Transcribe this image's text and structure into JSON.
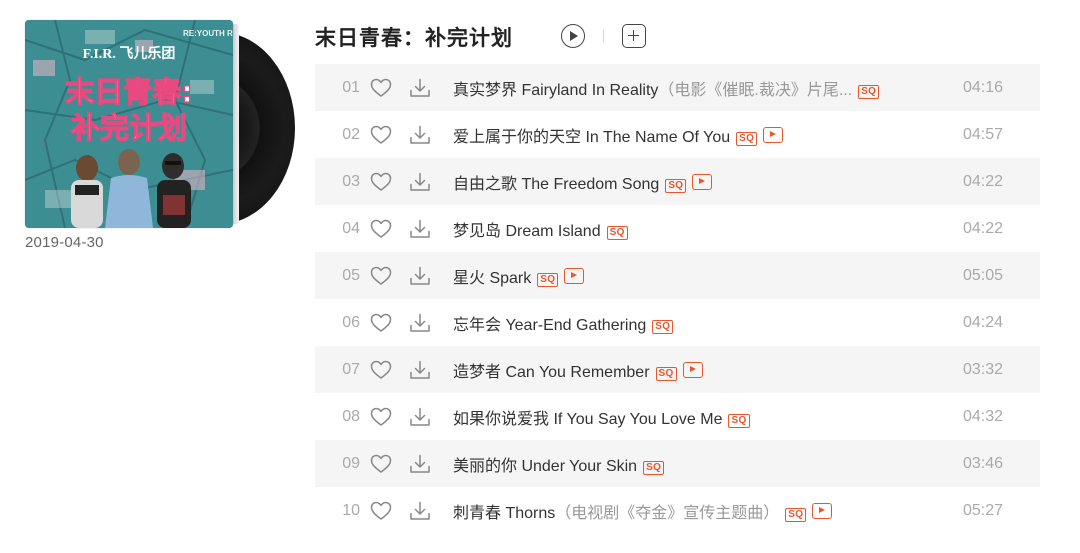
{
  "album": {
    "title": "末日青春：补完计划",
    "release_date": "2019-04-30",
    "cover": {
      "band_logo": "F.I.R. 飞儿乐团",
      "title_line1": "末日青春:",
      "title_line2": "补完计划",
      "side_text": "RE:YOUTH RE:YOUTH",
      "colors": {
        "teal": "#3d8e93",
        "pink": "#e84a7f",
        "white": "#ffffff"
      }
    }
  },
  "actions": {
    "play_all_icon": "play-circle-icon",
    "add_icon": "add-to-playlist-icon"
  },
  "colors": {
    "accent": "#e8562c",
    "row_stripe": "#f5f5f5",
    "muted_text": "#aaaaaa"
  },
  "tracks": [
    {
      "no": "01",
      "title": "真实梦界 Fairyland In Reality",
      "note": "（电影《催眠.裁决》片尾...",
      "sq": "SQ",
      "mv": false,
      "duration": "04:16"
    },
    {
      "no": "02",
      "title": "爱上属于你的天空 In The Name Of You",
      "note": "",
      "sq": "SQ",
      "mv": true,
      "duration": "04:57"
    },
    {
      "no": "03",
      "title": "自由之歌 The Freedom Song",
      "note": "",
      "sq": "SQ",
      "mv": true,
      "duration": "04:22"
    },
    {
      "no": "04",
      "title": "梦见岛 Dream Island",
      "note": "",
      "sq": "SQ",
      "mv": false,
      "duration": "04:22"
    },
    {
      "no": "05",
      "title": "星火 Spark",
      "note": "",
      "sq": "SQ",
      "mv": true,
      "duration": "05:05"
    },
    {
      "no": "06",
      "title": "忘年会 Year-End Gathering",
      "note": "",
      "sq": "SQ",
      "mv": false,
      "duration": "04:24"
    },
    {
      "no": "07",
      "title": "造梦者 Can You Remember",
      "note": "",
      "sq": "SQ",
      "mv": true,
      "duration": "03:32"
    },
    {
      "no": "08",
      "title": "如果你说爱我 If You Say You Love Me",
      "note": "",
      "sq": "SQ",
      "mv": false,
      "duration": "04:32"
    },
    {
      "no": "09",
      "title": "美丽的你 Under Your Skin",
      "note": "",
      "sq": "SQ",
      "mv": false,
      "duration": "03:46"
    },
    {
      "no": "10",
      "title": "刺青春 Thorns",
      "note": "（电视剧《夺金》宣传主题曲）",
      "sq": "SQ",
      "mv": true,
      "duration": "05:27"
    }
  ]
}
